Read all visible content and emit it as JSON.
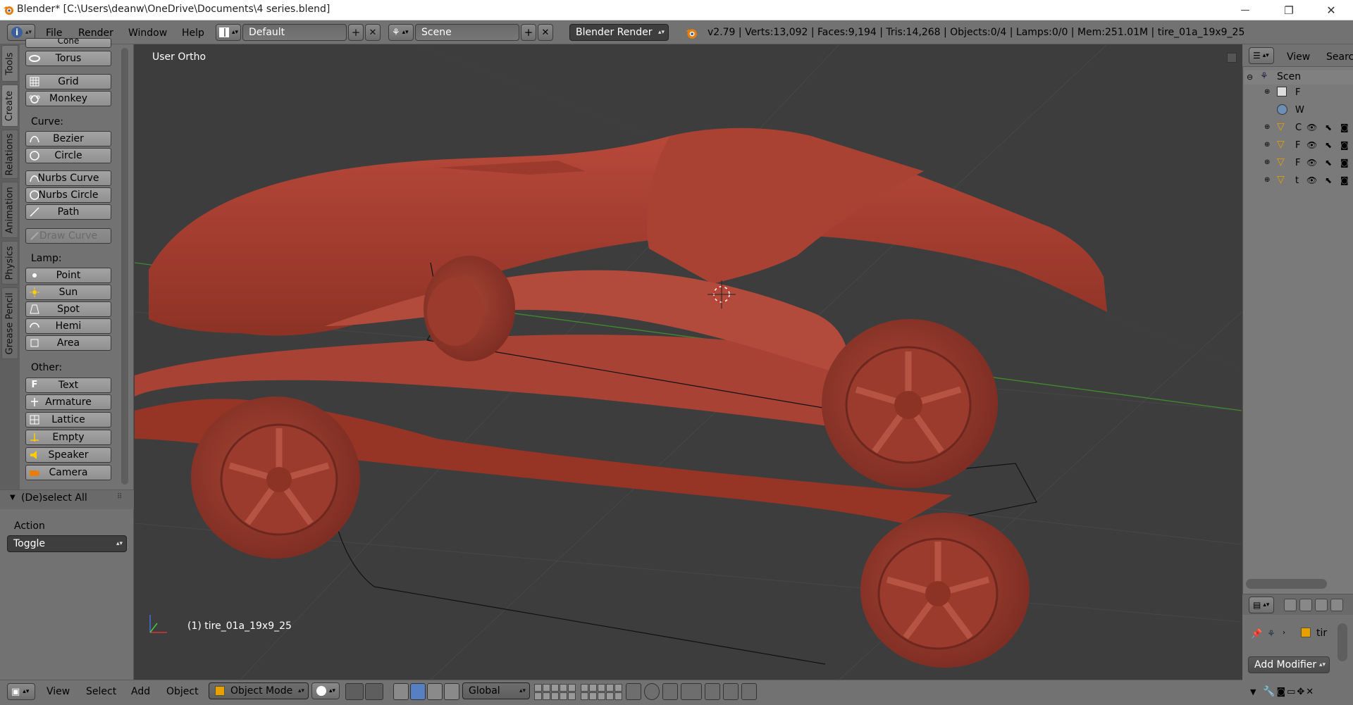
{
  "window": {
    "title": "Blender* [C:\\Users\\deanw\\OneDrive\\Documents\\4 series.blend]",
    "minimize_glyph": "—",
    "maximize_glyph": "❐",
    "close_glyph": "✕"
  },
  "info_header": {
    "menus": [
      "File",
      "Render",
      "Window",
      "Help"
    ],
    "screen_layout": "Default",
    "scene": "Scene",
    "render_engine": "Blender Render",
    "stats": "v2.79 | Verts:13,092 | Faces:9,194 | Tris:14,268 | Objects:0/4 | Lamps:0/0 | Mem:251.01M | tire_01a_19x9_25"
  },
  "tool_tabs": [
    "Tools",
    "Create",
    "Relations",
    "Animation",
    "Physics",
    "Grease Pencil"
  ],
  "tool_shelf": {
    "cut_item": "Cone",
    "mesh_items": [
      "Torus",
      "Grid",
      "Monkey"
    ],
    "curve_label": "Curve:",
    "curve_items": [
      "Bezier",
      "Circle"
    ],
    "curve_items2": [
      "Nurbs Curve",
      "Nurbs Circle",
      "Path"
    ],
    "draw_curve": "Draw Curve",
    "lamp_label": "Lamp:",
    "lamp_items": [
      "Point",
      "Sun",
      "Spot",
      "Hemi",
      "Area"
    ],
    "other_label": "Other:",
    "other_items": [
      "Text",
      "Armature",
      "Lattice",
      "Empty",
      "Speaker",
      "Camera"
    ]
  },
  "operator_panel": {
    "title": "(De)select All",
    "action_label": "Action",
    "action_value": "Toggle"
  },
  "viewport": {
    "view_name": "User Ortho",
    "active_object": "(1) tire_01a_19x9_25",
    "model_color": "#b8493a"
  },
  "outliner": {
    "view_menu": "View",
    "search": "Searc",
    "scene_label": "Scen",
    "rows": [
      "F",
      "W",
      "C",
      "F",
      "F",
      "t"
    ]
  },
  "properties": {
    "object_name": "tir",
    "add_modifier": "Add Modifier"
  },
  "bottom_header": {
    "menus": [
      "View",
      "Select",
      "Add",
      "Object"
    ],
    "mode": "Object Mode",
    "orientation": "Global"
  }
}
